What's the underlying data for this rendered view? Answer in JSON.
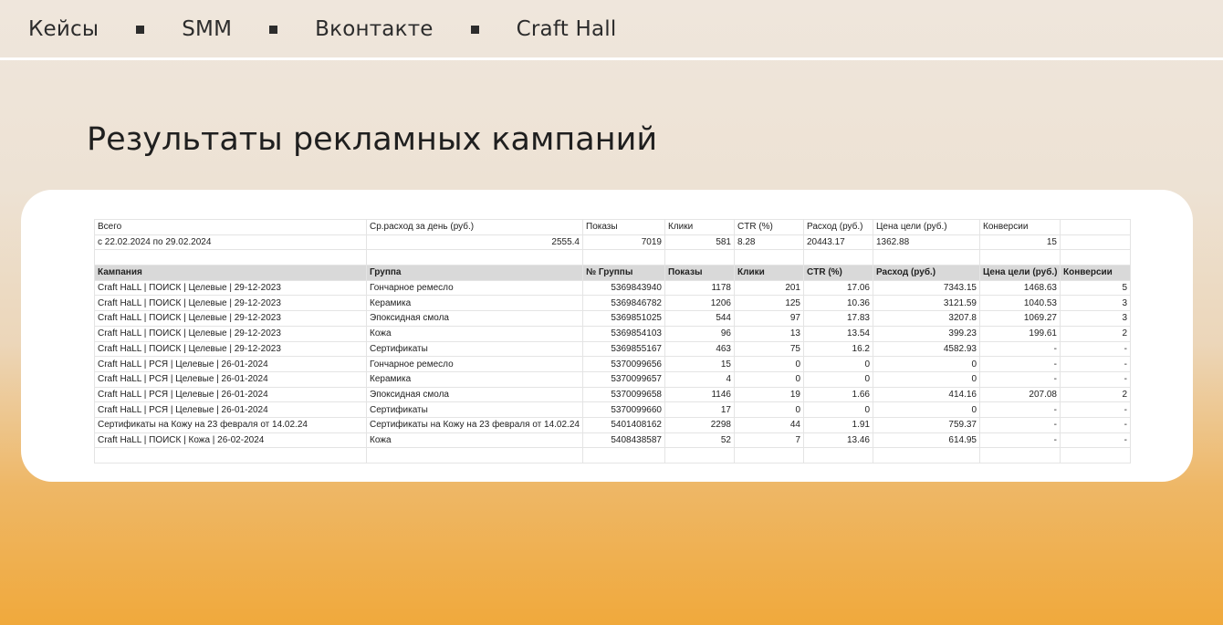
{
  "breadcrumb": [
    "Кейсы",
    "SMM",
    "Вконтакте",
    "Craft Hall"
  ],
  "title": "Результаты рекламных кампаний",
  "summary": {
    "headers": [
      "Всего",
      "Ср.расход за день (руб.)",
      "Показы",
      "Клики",
      "CTR (%)",
      "Расход (руб.)",
      "Цена цели (руб.)",
      "Конверсии"
    ],
    "values": [
      "с 22.02.2024 по 29.02.2024",
      "2555.4",
      "7019",
      "581",
      "8.28",
      "20443.17",
      "1362.88",
      "15"
    ]
  },
  "table": {
    "headers": [
      "Кампания",
      "Группа",
      "№ Группы",
      "Показы",
      "Клики",
      "CTR (%)",
      "Расход (руб.)",
      "Цена цели (руб.)",
      "Конверсии"
    ],
    "rows": [
      [
        "Craft HaLL | ПОИСК | Целевые | 29-12-2023",
        "Гончарное ремесло",
        "5369843940",
        "1178",
        "201",
        "17.06",
        "7343.15",
        "1468.63",
        "5"
      ],
      [
        "Craft HaLL | ПОИСК | Целевые | 29-12-2023",
        "Керамика",
        "5369846782",
        "1206",
        "125",
        "10.36",
        "3121.59",
        "1040.53",
        "3"
      ],
      [
        "Craft HaLL | ПОИСК | Целевые | 29-12-2023",
        "Эпоксидная смола",
        "5369851025",
        "544",
        "97",
        "17.83",
        "3207.8",
        "1069.27",
        "3"
      ],
      [
        "Craft HaLL | ПОИСК | Целевые | 29-12-2023",
        "Кожа",
        "5369854103",
        "96",
        "13",
        "13.54",
        "399.23",
        "199.61",
        "2"
      ],
      [
        "Craft HaLL | ПОИСК | Целевые | 29-12-2023",
        "Сертификаты",
        "5369855167",
        "463",
        "75",
        "16.2",
        "4582.93",
        "-",
        "-"
      ],
      [
        "Craft HaLL | РСЯ | Целевые | 26-01-2024",
        "Гончарное ремесло",
        "5370099656",
        "15",
        "0",
        "0",
        "0",
        "-",
        "-"
      ],
      [
        "Craft HaLL | РСЯ | Целевые | 26-01-2024",
        "Керамика",
        "5370099657",
        "4",
        "0",
        "0",
        "0",
        "-",
        "-"
      ],
      [
        "Craft HaLL | РСЯ | Целевые | 26-01-2024",
        "Эпоксидная смола",
        "5370099658",
        "1146",
        "19",
        "1.66",
        "414.16",
        "207.08",
        "2"
      ],
      [
        "Craft HaLL | РСЯ | Целевые | 26-01-2024",
        "Сертификаты",
        "5370099660",
        "17",
        "0",
        "0",
        "0",
        "-",
        "-"
      ],
      [
        "Сертификаты на Кожу на 23 февраля от 14.02.24",
        "Сертификаты на Кожу на 23 февраля от 14.02.24",
        "5401408162",
        "2298",
        "44",
        "1.91",
        "759.37",
        "-",
        "-"
      ],
      [
        "Craft HaLL | ПОИСК | Кожа | 26-02-2024",
        "Кожа",
        "5408438587",
        "52",
        "7",
        "13.46",
        "614.95",
        "-",
        "-"
      ]
    ]
  }
}
